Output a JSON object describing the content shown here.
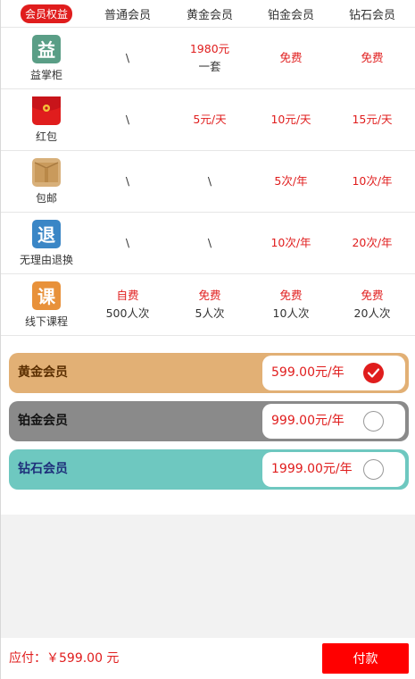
{
  "header": {
    "label": "会员权益",
    "tiers": [
      "普通会员",
      "黄金会员",
      "铂金会员",
      "钻石会员"
    ]
  },
  "benefits": [
    {
      "label": "益掌柜",
      "icon": "yi-icon",
      "icon_char": "益",
      "icon_color": "#5a9e86",
      "values": [
        {
          "line1": "\\",
          "line2": ""
        },
        {
          "line1": "1980元",
          "line2": "一套"
        },
        {
          "line1": "免费",
          "line2": ""
        },
        {
          "line1": "免费",
          "line2": ""
        }
      ]
    },
    {
      "label": "红包",
      "icon": "red-envelope-icon",
      "icon_char": "",
      "icon_color": "#e01d1d",
      "values": [
        {
          "line1": "\\",
          "line2": ""
        },
        {
          "line1": "5元/天",
          "line2": ""
        },
        {
          "line1": "10元/天",
          "line2": ""
        },
        {
          "line1": "15元/天",
          "line2": ""
        }
      ]
    },
    {
      "label": "包邮",
      "icon": "package-box-icon",
      "icon_char": "",
      "icon_color": "#d8b07a",
      "values": [
        {
          "line1": "\\",
          "line2": ""
        },
        {
          "line1": "\\",
          "line2": ""
        },
        {
          "line1": "5次/年",
          "line2": ""
        },
        {
          "line1": "10次/年",
          "line2": ""
        }
      ]
    },
    {
      "label": "无理由退换",
      "icon": "return-icon",
      "icon_char": "退",
      "icon_color": "#3a86c6",
      "values": [
        {
          "line1": "\\",
          "line2": ""
        },
        {
          "line1": "\\",
          "line2": ""
        },
        {
          "line1": "10次/年",
          "line2": ""
        },
        {
          "line1": "20次/年",
          "line2": ""
        }
      ]
    },
    {
      "label": "线下课程",
      "icon": "course-icon",
      "icon_char": "课",
      "icon_color": "#e8913a",
      "values": [
        {
          "line1": "自费",
          "line2": "500人次"
        },
        {
          "line1": "免费",
          "line2": "5人次"
        },
        {
          "line1": "免费",
          "line2": "10人次"
        },
        {
          "line1": "免费",
          "line2": "20人次"
        }
      ]
    }
  ],
  "plans": [
    {
      "name": "黄金会员",
      "price": "599.00元/年",
      "selected": true,
      "bg": "#e2b075",
      "name_color": "#5a2e00"
    },
    {
      "name": "铂金会员",
      "price": "999.00元/年",
      "selected": false,
      "bg": "#8a8a8a",
      "name_color": "#111111"
    },
    {
      "name": "钻石会员",
      "price": "1999.00元/年",
      "selected": false,
      "bg": "#6ec8c0",
      "name_color": "#1e2f7a"
    }
  ],
  "footer": {
    "total": "应付：￥599.00 元",
    "pay_label": "付款"
  },
  "colors": {
    "accent": "#e01d1d",
    "pay_button": "#ff0000"
  }
}
